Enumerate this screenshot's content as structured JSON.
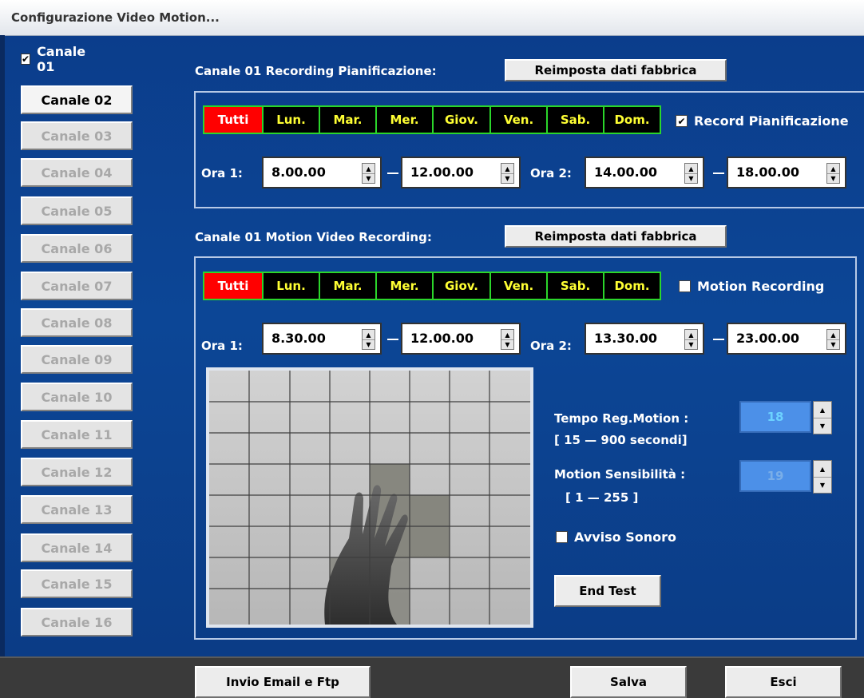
{
  "window": {
    "title": "Configurazione Video Motion..."
  },
  "channels": {
    "checkbox_label": "Canale 01",
    "checked": true,
    "items": [
      "Canale 02",
      "Canale 03",
      "Canale 04",
      "Canale 05",
      "Canale 06",
      "Canale 07",
      "Canale 08",
      "Canale 09",
      "Canale 10",
      "Canale 11",
      "Canale 12",
      "Canale 13",
      "Canale 14",
      "Canale 15",
      "Canale 16"
    ]
  },
  "recording": {
    "header": "Canale 01 Recording Pianificazione:",
    "reset_label": "Reimposta dati fabbrica",
    "days": [
      "Tutti",
      "Lun.",
      "Mar.",
      "Mer.",
      "Giov.",
      "Ven.",
      "Sab.",
      "Dom."
    ],
    "option_label": "Record Pianificazione",
    "option_checked": true,
    "ora1_label": "Ora 1:",
    "ora1_from": "8.00.00",
    "ora1_to": "12.00.00",
    "ora2_label": "Ora 2:",
    "ora2_from": "14.00.00",
    "ora2_to": "18.00.00"
  },
  "motion": {
    "header": "Canale 01 Motion Video Recording:",
    "reset_label": "Reimposta dati fabbrica",
    "days": [
      "Tutti",
      "Lun.",
      "Mar.",
      "Mer.",
      "Giov.",
      "Ven.",
      "Sab.",
      "Dom."
    ],
    "option_label": "Motion Recording",
    "option_checked": false,
    "ora1_label": "Ora 1:",
    "ora1_from": "8.30.00",
    "ora1_to": "12.00.00",
    "ora2_label": "Ora 2:",
    "ora2_from": "13.30.00",
    "ora2_to": "23.00.00",
    "tempo_label": "Tempo Reg.Motion :",
    "tempo_range": "[ 15 — 900 secondi]",
    "tempo_value": "18",
    "sens_label": "Motion Sensibilità :",
    "sens_range": "[ 1 — 255 ]",
    "sens_value": "19",
    "avviso_label": "Avviso Sonoro",
    "avviso_checked": false,
    "end_test_label": "End Test"
  },
  "footer": {
    "email_label": "Invio Email e Ftp",
    "save_label": "Salva",
    "exit_label": "Esci"
  }
}
